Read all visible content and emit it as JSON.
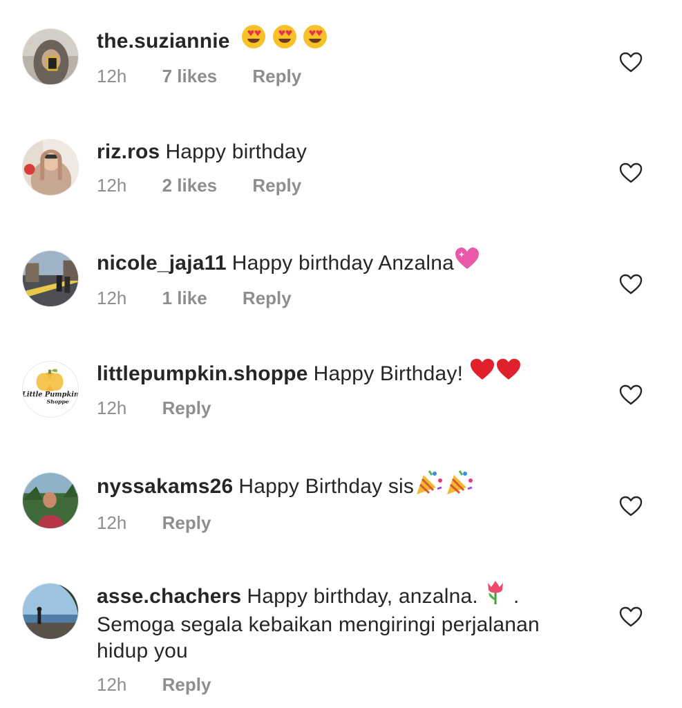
{
  "comments": [
    {
      "username": "the.suziannie",
      "text": "",
      "emojis": [
        "heart-eyes",
        "heart-eyes",
        "heart-eyes"
      ],
      "time": "12h",
      "likes": "7 likes",
      "reply": "Reply"
    },
    {
      "username": "riz.ros",
      "text": "Happy birthday",
      "emojis": [],
      "time": "12h",
      "likes": "2 likes",
      "reply": "Reply"
    },
    {
      "username": "nicole_jaja11",
      "text": "Happy birthday Anzalna",
      "emojis": [
        "sparkling-heart"
      ],
      "time": "12h",
      "likes": "1 like",
      "reply": "Reply"
    },
    {
      "username": "littlepumpkin.shoppe",
      "text": "Happy Birthday!",
      "emojis": [
        "red-heart",
        "red-heart"
      ],
      "time": "12h",
      "likes": "",
      "reply": "Reply"
    },
    {
      "username": "nyssakams26",
      "text": "Happy Birthday sis",
      "emojis": [
        "party-popper",
        "party-popper"
      ],
      "time": "12h",
      "likes": "",
      "reply": "Reply"
    },
    {
      "username": "asse.chachers",
      "text": "Happy birthday, anzalna.",
      "text_after_emoji": ". Semoga segala kebaikan mengiringi perjalanan hidup you",
      "emojis": [
        "tulip"
      ],
      "time": "12h",
      "likes": "",
      "reply": "Reply"
    }
  ],
  "colors": {
    "text": "#262626",
    "meta": "#8e8e8e",
    "heart_outline": "#262626"
  }
}
